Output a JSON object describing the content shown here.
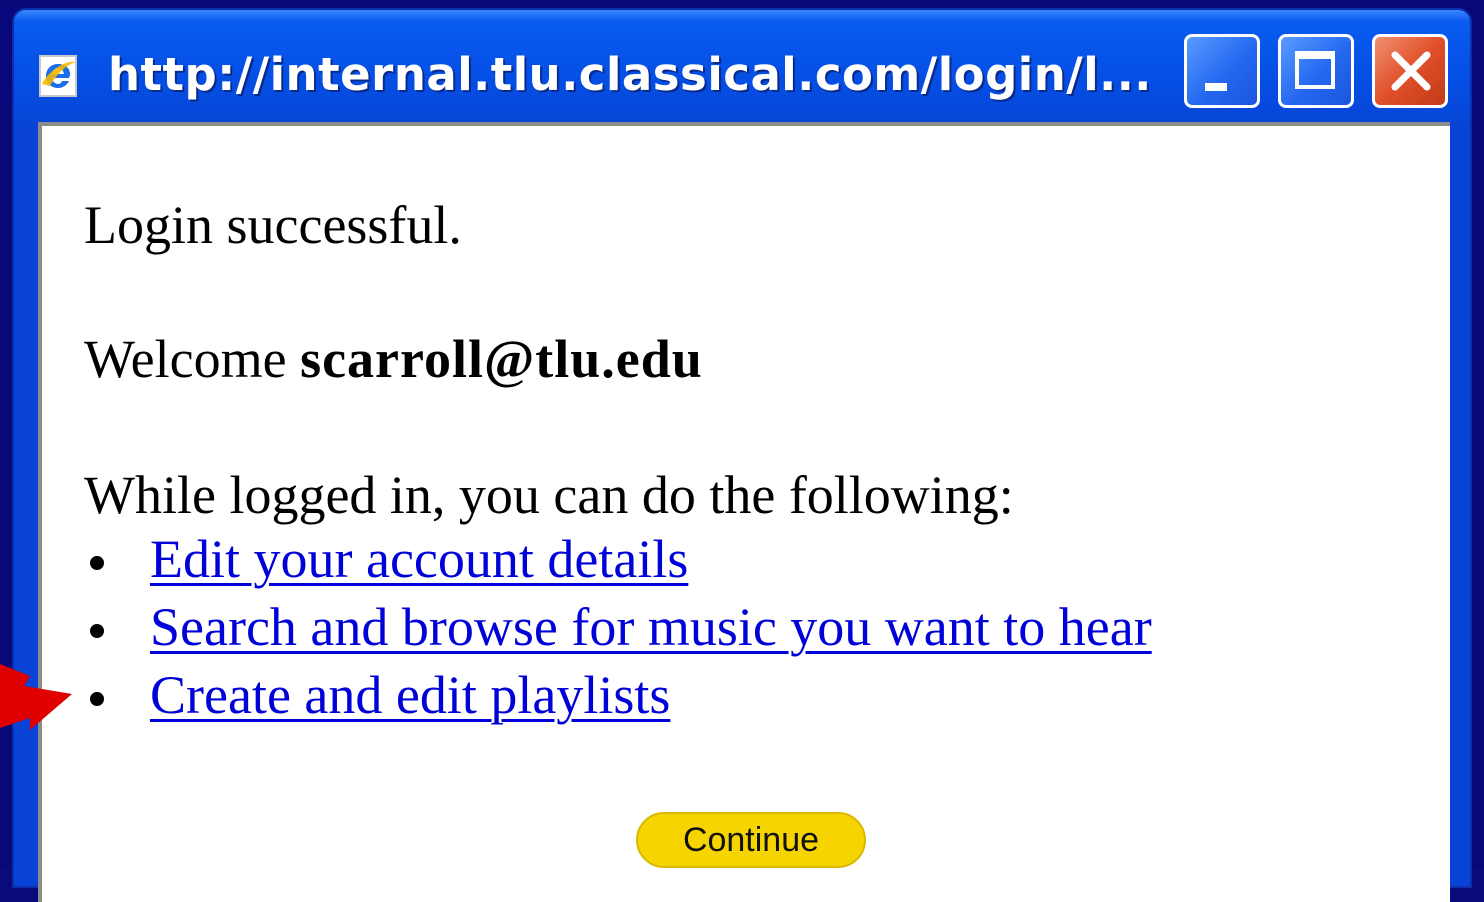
{
  "window": {
    "title": "http://internal.tlu.classical.com/login/l...",
    "controls": {
      "minimize": "minimize",
      "maximize": "maximize",
      "close": "close"
    }
  },
  "page": {
    "login_message": "Login successful.",
    "welcome_prefix": "Welcome ",
    "username": "scarroll@tlu.edu",
    "intro": "While logged in, you can do the following:",
    "actions": [
      {
        "label": "Edit your account details"
      },
      {
        "label": "Search and browse for music you want to hear"
      },
      {
        "label": "Create and edit playlists"
      }
    ],
    "continue_label": "Continue"
  },
  "colors": {
    "titlebar": "#0550e6",
    "link": "#0000d8",
    "continue_button": "#f5d400",
    "arrow": "#e00000"
  },
  "icons": {
    "app": "internet-explorer-icon",
    "annotation": "red-arrow-pointer"
  }
}
